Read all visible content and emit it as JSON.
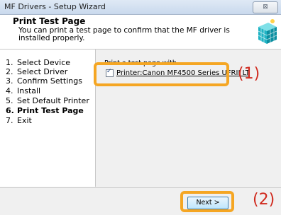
{
  "window": {
    "title": "MF Drivers - Setup Wizard",
    "close_label": "⊠"
  },
  "header": {
    "title": "Print Test Page",
    "subtitle": "You can print a test page to confirm that the MF driver is installed properly."
  },
  "sidebar": {
    "steps": [
      {
        "num": "1.",
        "label": "Select Device"
      },
      {
        "num": "2.",
        "label": "Select Driver"
      },
      {
        "num": "3.",
        "label": "Confirm Settings"
      },
      {
        "num": "4.",
        "label": "Install"
      },
      {
        "num": "5.",
        "label": "Set Default Printer"
      },
      {
        "num": "6.",
        "label": "Print Test Page"
      },
      {
        "num": "7.",
        "label": "Exit"
      }
    ],
    "active_index": 5
  },
  "content": {
    "label": "Print a test page with",
    "printer_checkbox_label": "Printer:Canon MF4500 Series UFRII LT",
    "printer_checked": true
  },
  "footer": {
    "next_label": "Next >"
  },
  "annotations": {
    "callout_1": "(1)",
    "callout_2": "(2)"
  },
  "colors": {
    "callout_border": "#f5a623",
    "callout_text": "#d02a1e"
  }
}
